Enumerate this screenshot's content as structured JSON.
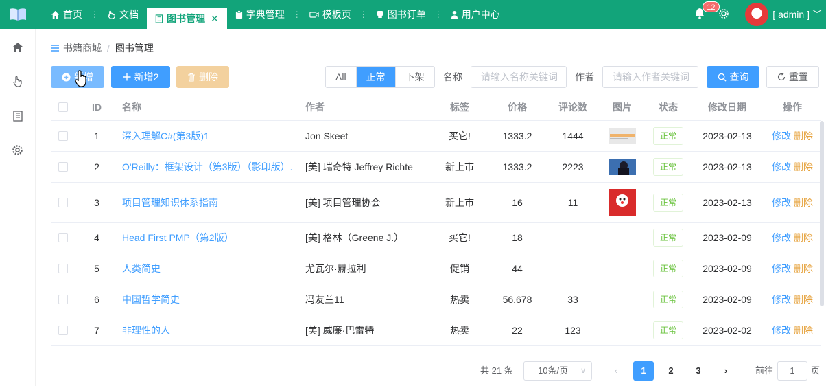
{
  "nav": {
    "tabs": [
      {
        "label": "首页",
        "icon": "home-icon"
      },
      {
        "label": "文档",
        "icon": "hand-icon"
      },
      {
        "label": "图书管理",
        "icon": "book-icon",
        "active": true
      },
      {
        "label": "字典管理",
        "icon": "clipboard-icon"
      },
      {
        "label": "模板页",
        "icon": "video-icon"
      },
      {
        "label": "图书订单",
        "icon": "cart-icon"
      },
      {
        "label": "用户中心",
        "icon": "user-icon"
      }
    ],
    "badge_count": "12",
    "user": "[ admin ]"
  },
  "breadcrumb": {
    "root": "书籍商城",
    "current": "图书管理"
  },
  "toolbar": {
    "add_label": "新增",
    "add2_label": "新增2",
    "delete_label": "删除",
    "status_options": [
      "All",
      "正常",
      "下架"
    ],
    "status_selected": "正常",
    "name_label": "名称",
    "name_placeholder": "请输入名称关键词",
    "author_label": "作者",
    "author_placeholder": "请输入作者关键词",
    "query_label": "查询",
    "reset_label": "重置"
  },
  "table": {
    "headers": [
      "ID",
      "名称",
      "作者",
      "标签",
      "价格",
      "评论数",
      "图片",
      "状态",
      "修改日期",
      "操作"
    ],
    "edit_label": "修改",
    "delete_label": "删除",
    "rows": [
      {
        "id": "1",
        "name": "深入理解C#(第3版)1",
        "author": "Jon Skeet",
        "tag": "买它!",
        "price": "1333.2",
        "comments": "1444",
        "status": "正常",
        "date": "2023-02-13"
      },
      {
        "id": "2",
        "name": "O'Reilly：框架设计（第3版）（影印版）.",
        "author": "[美] 瑞奇特 Jeffrey Richte",
        "tag": "新上市",
        "price": "1333.2",
        "comments": "2223",
        "status": "正常",
        "date": "2023-02-13"
      },
      {
        "id": "3",
        "name": "项目管理知识体系指南",
        "author": "[美] 项目管理协会",
        "tag": "新上市",
        "price": "16",
        "comments": "11",
        "status": "正常",
        "date": "2023-02-13"
      },
      {
        "id": "4",
        "name": "Head First PMP（第2版）",
        "author": "[美] 格林（Greene J.）",
        "tag": "买它!",
        "price": "18",
        "comments": "",
        "status": "正常",
        "date": "2023-02-09"
      },
      {
        "id": "5",
        "name": "人类简史",
        "author": "尤瓦尔·赫拉利",
        "tag": "促销",
        "price": "44",
        "comments": "",
        "status": "正常",
        "date": "2023-02-09"
      },
      {
        "id": "6",
        "name": "中国哲学简史",
        "author": "冯友兰11",
        "tag": "热卖",
        "price": "56.678",
        "comments": "33",
        "status": "正常",
        "date": "2023-02-09"
      },
      {
        "id": "7",
        "name": "非理性的人",
        "author": "[美] 威廉·巴雷特",
        "tag": "热卖",
        "price": "22",
        "comments": "123",
        "status": "正常",
        "date": "2023-02-02"
      }
    ]
  },
  "pagination": {
    "total": "共 21 条",
    "page_size": "10条/页",
    "pages": [
      "1",
      "2",
      "3"
    ],
    "current_page": "1",
    "goto_label": "前往",
    "goto_value": "1",
    "page_suffix": "页"
  },
  "colors": {
    "brand": "#12a47a",
    "primary": "#409eff",
    "warning": "#e6a23c",
    "success": "#67c23a"
  }
}
